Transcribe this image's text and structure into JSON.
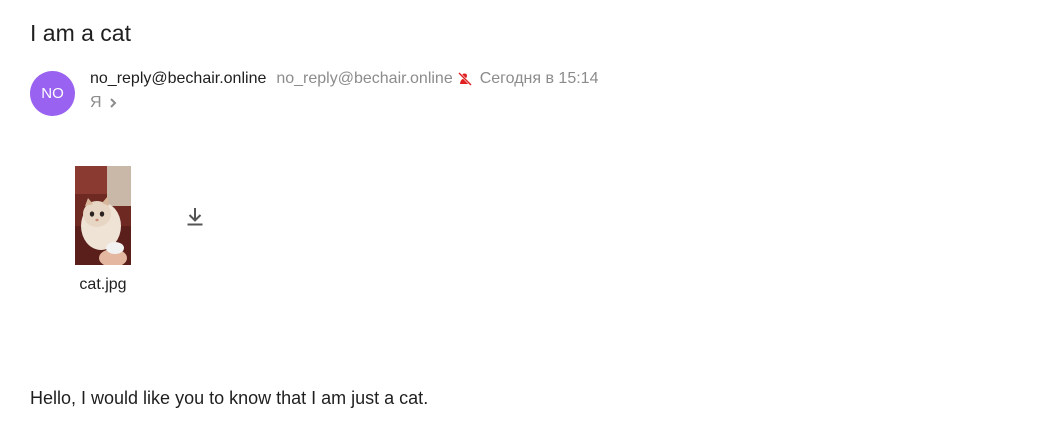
{
  "message": {
    "subject": "I am a cat",
    "sender": {
      "avatar_initials": "NO",
      "avatar_color": "#9a62f0",
      "name": "no_reply@bechair.online",
      "email": "no_reply@bechair.online",
      "warning_icon": "unverified-sender-icon",
      "date": "Сегодня в 15:14"
    },
    "recipient": {
      "label": "Я",
      "expand_icon": "chevron-right-icon"
    },
    "attachments": [
      {
        "filename": "cat.jpg",
        "preview": "cat photo thumbnail"
      }
    ],
    "download_icon": "download-icon",
    "body": "Hello, I would like you to know that I am just a cat."
  },
  "colors": {
    "accent_avatar": "#9a62f0",
    "secondary_text": "#8c8c8c",
    "warning_red": "#e02020"
  }
}
